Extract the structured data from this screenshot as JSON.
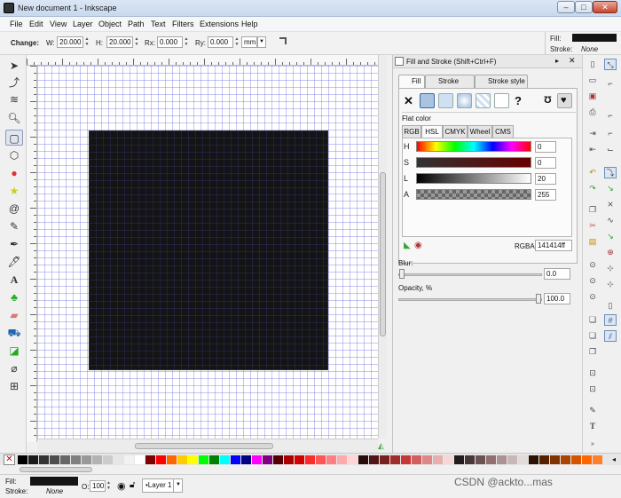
{
  "window": {
    "title": "New document 1 - Inkscape",
    "buttons": [
      "–",
      "□",
      "✕"
    ]
  },
  "menu": [
    "File",
    "Edit",
    "View",
    "Layer",
    "Object",
    "Path",
    "Text",
    "Filters",
    "Extensions",
    "Help"
  ],
  "toolcontrols": {
    "change_label": "Change:",
    "w_label": "W:",
    "w_value": "20.000",
    "h_label": "H:",
    "h_value": "20.000",
    "rx_label": "Rx:",
    "rx_value": "0.000",
    "ry_label": "Ry:",
    "ry_value": "0.000",
    "unit": "mm"
  },
  "style_indicator": {
    "fill_label": "Fill:",
    "stroke_label": "Stroke:",
    "stroke_value": "None",
    "fill_color": "#141414"
  },
  "dialog": {
    "title": "Fill and Stroke (Shift+Ctrl+F)",
    "tabs": [
      "Fill",
      "Stroke paint",
      "Stroke style"
    ],
    "paint_none_icon": "x-icon",
    "unknown_icon": "?",
    "flat_color_label": "Flat color",
    "color_tabs": [
      "RGB",
      "HSL",
      "CMYK",
      "Wheel",
      "CMS"
    ],
    "channels": [
      {
        "label": "H",
        "value": "0"
      },
      {
        "label": "S",
        "value": "0"
      },
      {
        "label": "L",
        "value": "20"
      },
      {
        "label": "A",
        "value": "255"
      }
    ],
    "rgba_label": "RGBA:",
    "rgba_value": "141414ff",
    "blur_label": "Blur:",
    "blur_value": "0.0",
    "opacity_label": "Opacity, %",
    "opacity_value": "100.0"
  },
  "status": {
    "fill_label": "Fill:",
    "stroke_label": "Stroke:",
    "stroke_value": "None",
    "o_label": "O:",
    "o_value": "100",
    "layer": "•Layer 1"
  },
  "watermark": "CSDN @ackto...mas",
  "palette_colors": [
    "#000000",
    "#1a1a1a",
    "#333333",
    "#4d4d4d",
    "#666666",
    "#808080",
    "#999999",
    "#b3b3b3",
    "#cccccc",
    "#e6e6e6",
    "#f2f2f2",
    "#ffffff",
    "#800000",
    "#ff0000",
    "#ff6600",
    "#ffcc00",
    "#ffff00",
    "#00ff00",
    "#008000",
    "#00ffff",
    "#0000ff",
    "#000080",
    "#ff00ff",
    "#800080",
    "#550000",
    "#aa0000",
    "#d40000",
    "#ff2a2a",
    "#ff5555",
    "#ff8080",
    "#ffaaaa",
    "#ffd5d5",
    "#280b0b",
    "#501616",
    "#782121",
    "#a02c2c",
    "#c83737",
    "#d35f5f",
    "#de8787",
    "#e9afaf",
    "#f4d7d7",
    "#241c1c",
    "#483737",
    "#6c5353",
    "#916f6f",
    "#ac9393",
    "#c8b7b7",
    "#e3dbdb",
    "#2b1100",
    "#552200",
    "#803300",
    "#aa4400",
    "#d45500",
    "#ff6600",
    "#ff7f2a"
  ]
}
